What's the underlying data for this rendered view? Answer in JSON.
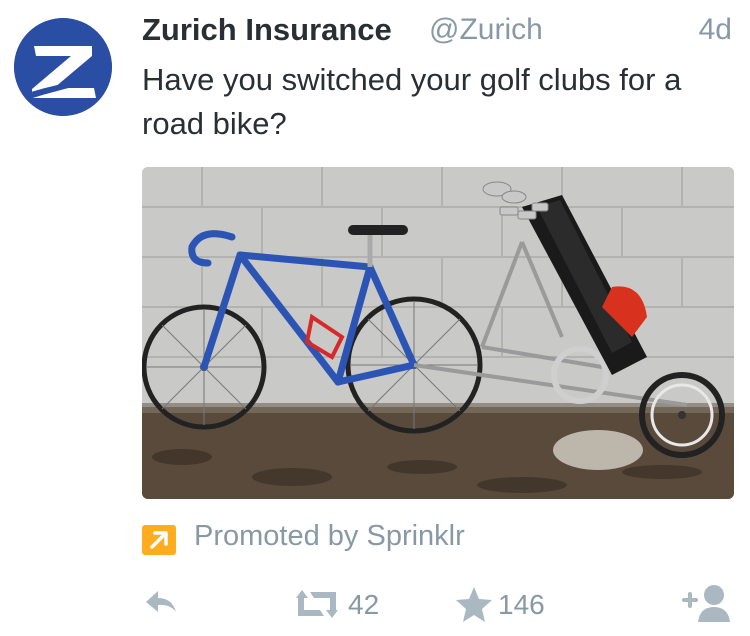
{
  "tweet": {
    "author_name": "Zurich Insurance",
    "handle": "@Zurich",
    "time": "4d",
    "text": "Have you switched your golf clubs for a road bike?",
    "avatar_letter": "Z"
  },
  "promoted": {
    "text": "Promoted by Sprinklr",
    "icon": "promoted-arrow-icon",
    "icon_color": "#ffad1f"
  },
  "actions": {
    "reply_icon": "reply-icon",
    "retweet_icon": "retweet-icon",
    "retweet_count": "42",
    "favorite_icon": "star-icon",
    "favorite_count": "146",
    "follow_icon": "follow-user-icon"
  },
  "colors": {
    "brand_blue": "#2a4ea3",
    "muted_text": "#8899a6",
    "body_text": "#292f33"
  }
}
